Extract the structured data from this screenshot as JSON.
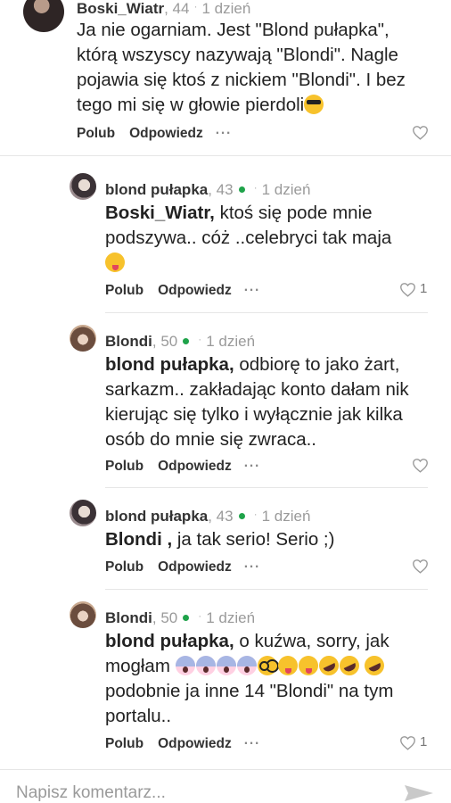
{
  "comments": [
    {
      "user": "Boski_Wiatr",
      "rank": ", 44",
      "online": false,
      "time": "1 dzień",
      "segments": [
        {
          "text": "Ja nie ogarniam. Jest \"Blond pułapka\", którą wszyscy nazywają \"Blondi\". Nagle pojawia się ktoś z nickiem \"Blondi\". I bez tego mi się w głowie pierdoli"
        }
      ],
      "emoji": [
        "smiling-face-with-sunglasses"
      ],
      "actions": {
        "like": "Polub",
        "reply": "Odpowiedz",
        "more": "···"
      },
      "likes": ""
    },
    {
      "user": "blond pułapka",
      "rank": ", 43",
      "online": true,
      "time": "1 dzień",
      "mention": "Boski_Wiatr,",
      "text": " ktoś się pode mnie podszywa..  cóż ..celebryci tak maja",
      "emoji": [
        "winking-face-with-tongue"
      ],
      "actions": {
        "like": "Polub",
        "reply": "Odpowiedz",
        "more": "···"
      },
      "likes": "1"
    },
    {
      "user": "Blondi",
      "rank": ", 50",
      "online": true,
      "time": "1 dzień",
      "mention": "blond pułapka,",
      "text": " odbiorę to jako żart, sarkazm.. zakładając konto dałam nik kierując się tylko i wyłącznie jak kilka osób do mnie się zwraca..",
      "emoji": [],
      "actions": {
        "like": "Polub",
        "reply": "Odpowiedz",
        "more": "···"
      },
      "likes": ""
    },
    {
      "user": "blond pułapka",
      "rank": ", 43",
      "online": true,
      "time": "1 dzień",
      "mention": "Blondi ,",
      "text": " ja tak serio! Serio ;)",
      "emoji": [],
      "actions": {
        "like": "Polub",
        "reply": "Odpowiedz",
        "more": "···"
      },
      "likes": ""
    },
    {
      "user": "Blondi",
      "rank": ", 50",
      "online": true,
      "time": "1 dzień",
      "mention": "blond pułapka,",
      "text_a": " o kuźwa, sorry, jak mogłam ",
      "text_b": " podobnie ja inne 14 \"Blondi\" na tym portalu..",
      "emoji": [
        "face-screaming-in-fear",
        "face-screaming-in-fear",
        "face-screaming-in-fear",
        "face-screaming-in-fear",
        "nerd-face",
        "winking-face-with-tongue",
        "winking-face-with-tongue",
        "rolling-on-the-floor-laughing",
        "rolling-on-the-floor-laughing",
        "rolling-on-the-floor-laughing"
      ],
      "actions": {
        "like": "Polub",
        "reply": "Odpowiedz",
        "more": "···"
      },
      "likes": "1"
    }
  ],
  "composer": {
    "placeholder": "Napisz komentarz..."
  },
  "colors": {
    "online": "#1fa34a",
    "meta_gray": "#9a9a9a",
    "divider": "#e6e6e6"
  }
}
